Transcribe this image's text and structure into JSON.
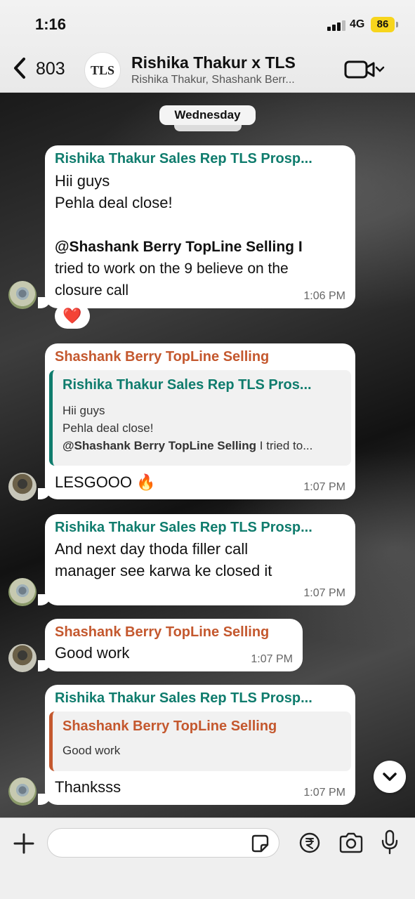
{
  "status_bar": {
    "time": "1:16",
    "network": "4G",
    "battery": "86"
  },
  "header": {
    "back_count": "803",
    "avatar_text": "TLS",
    "title": "Rishika Thakur x TLS",
    "subtitle": "Rishika Thakur, Shashank Berr..."
  },
  "chat": {
    "day_label": "Wednesday",
    "messages": [
      {
        "sender": "Rishika Thakur Sales Rep TLS Prosp...",
        "lines": [
          "Hii guys",
          "Pehla deal close!",
          "",
          "@Shashank Berry TopLine Selling I",
          "tried to work on the 9 believe on the",
          "closure call"
        ],
        "mention": "@Shashank Berry TopLine Selling",
        "time": "1:06 PM",
        "reaction": "❤️"
      },
      {
        "sender": "Shashank Berry TopLine Selling",
        "quote": {
          "sender": "Rishika Thakur Sales Rep TLS Pros...",
          "line1": "Hii guys",
          "line2": "Pehla deal close!",
          "line3_mention": "@Shashank Berry TopLine Selling",
          "line3_rest": " I tried to..."
        },
        "text": "LESGOOO 🔥",
        "time": "1:07 PM"
      },
      {
        "sender": "Rishika Thakur Sales Rep TLS Prosp...",
        "lines": [
          "And next day thoda filler call",
          "manager see karwa ke closed it"
        ],
        "time": "1:07 PM"
      },
      {
        "sender": "Shashank Berry TopLine Selling",
        "text": "Good work",
        "time": "1:07 PM"
      },
      {
        "sender": "Rishika Thakur Sales Rep TLS Prosp...",
        "quote": {
          "sender": "Shashank Berry TopLine Selling",
          "line1": "Good work"
        },
        "text": "Thanksss",
        "time": "1:07 PM"
      }
    ]
  },
  "colors": {
    "green_sender": "#0f7c6d",
    "orange_sender": "#c4582e",
    "battery": "#f7d51c"
  },
  "icons": [
    "chevron-left-icon",
    "video-call-icon",
    "plus-icon",
    "sticker-icon",
    "rupee-icon",
    "camera-icon",
    "mic-icon",
    "chevron-down-icon"
  ]
}
